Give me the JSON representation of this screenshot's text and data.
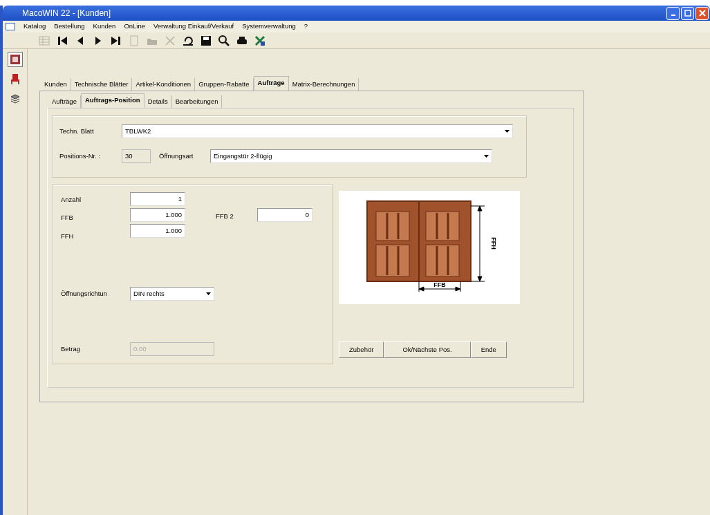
{
  "window": {
    "title": "MacoWIN 22 - [Kunden]"
  },
  "menu": [
    "Katalog",
    "Bestellung",
    "Kunden",
    "OnLine",
    "Verwaltung Einkauf/Verkauf",
    "Systemverwaltung",
    "?"
  ],
  "toolbar": [
    {
      "kind": "grid",
      "disabled": true
    },
    {
      "kind": "first",
      "disabled": false
    },
    {
      "kind": "prev",
      "disabled": false
    },
    {
      "kind": "next",
      "disabled": false
    },
    {
      "kind": "last",
      "disabled": false
    },
    {
      "kind": "new",
      "disabled": true
    },
    {
      "kind": "open",
      "disabled": true
    },
    {
      "kind": "delete",
      "disabled": true
    },
    {
      "kind": "undo",
      "disabled": false
    },
    {
      "kind": "save",
      "disabled": false
    },
    {
      "kind": "search",
      "disabled": false
    },
    {
      "kind": "print",
      "disabled": false
    },
    {
      "kind": "export",
      "disabled": false
    }
  ],
  "sidebar": [
    {
      "kind": "module",
      "selected": true
    },
    {
      "kind": "chair",
      "selected": false
    },
    {
      "kind": "stack",
      "selected": false
    }
  ],
  "tabs": [
    {
      "label": "Kunden",
      "selected": false
    },
    {
      "label": "Technische Blätter",
      "selected": false
    },
    {
      "label": "Artikel-Konditionen",
      "selected": false
    },
    {
      "label": "Gruppen-Rabatte",
      "selected": false
    },
    {
      "label": "Aufträge",
      "selected": true
    },
    {
      "label": "Matrix-Berechnungen",
      "selected": false
    }
  ],
  "subtabs": [
    {
      "label": "Aufträge",
      "selected": false
    },
    {
      "label": "Auftrags-Position",
      "selected": true
    },
    {
      "label": "Details",
      "selected": false
    },
    {
      "label": "Bearbeitungen",
      "selected": false
    }
  ],
  "header": {
    "techn_blatt": {
      "label": "Techn. Blatt",
      "value": "TBLWK2"
    },
    "position": {
      "label": "Positions-Nr. :",
      "value": "30"
    },
    "oeffnungsart": {
      "label": "Öffnungsart",
      "value": "Eingangstür 2-flügig"
    }
  },
  "fields": {
    "anzahl": {
      "label": "Anzahl",
      "value": "1"
    },
    "ffb": {
      "label": "FFB",
      "value": "1.000"
    },
    "ffb2": {
      "label": "FFB 2",
      "value": "0"
    },
    "ffh": {
      "label": "FFH",
      "value": "1.000"
    },
    "richtung": {
      "label": "Öffnungsrichtun",
      "value": "DIN rechts"
    },
    "betrag": {
      "label": "Betrag",
      "value": "0,00",
      "disabled": true
    }
  },
  "diagram": {
    "height_label": "FFH",
    "width_label": "FFB"
  },
  "buttons": [
    "Zubehör",
    "Ok/Nächste Pos.",
    "Ende"
  ]
}
